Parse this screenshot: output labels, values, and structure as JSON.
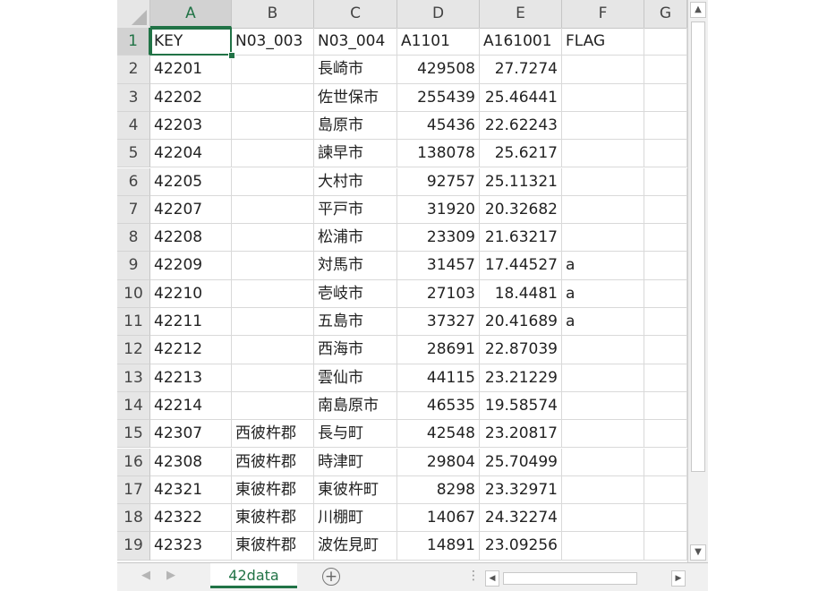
{
  "sheet": {
    "columns": [
      "A",
      "B",
      "C",
      "D",
      "E",
      "F",
      "G"
    ],
    "selected_column": "A",
    "selected_row": "1",
    "rows": [
      {
        "num": "1",
        "cells": [
          "KEY",
          "N03_003",
          "N03_004",
          "A1101",
          "A161001",
          "FLAG"
        ]
      },
      {
        "num": "2",
        "cells": [
          "42201",
          "",
          "長崎市",
          "429508",
          "27.7274",
          ""
        ]
      },
      {
        "num": "3",
        "cells": [
          "42202",
          "",
          "佐世保市",
          "255439",
          "25.46441",
          ""
        ]
      },
      {
        "num": "4",
        "cells": [
          "42203",
          "",
          "島原市",
          "45436",
          "22.62243",
          ""
        ]
      },
      {
        "num": "5",
        "cells": [
          "42204",
          "",
          "諫早市",
          "138078",
          "25.6217",
          ""
        ]
      },
      {
        "num": "6",
        "cells": [
          "42205",
          "",
          "大村市",
          "92757",
          "25.11321",
          ""
        ]
      },
      {
        "num": "7",
        "cells": [
          "42207",
          "",
          "平戸市",
          "31920",
          "20.32682",
          ""
        ]
      },
      {
        "num": "8",
        "cells": [
          "42208",
          "",
          "松浦市",
          "23309",
          "21.63217",
          ""
        ]
      },
      {
        "num": "9",
        "cells": [
          "42209",
          "",
          "対馬市",
          "31457",
          "17.44527",
          "a"
        ]
      },
      {
        "num": "10",
        "cells": [
          "42210",
          "",
          "壱岐市",
          "27103",
          "18.4481",
          "a"
        ]
      },
      {
        "num": "11",
        "cells": [
          "42211",
          "",
          "五島市",
          "37327",
          "20.41689",
          "a"
        ]
      },
      {
        "num": "12",
        "cells": [
          "42212",
          "",
          "西海市",
          "28691",
          "22.87039",
          ""
        ]
      },
      {
        "num": "13",
        "cells": [
          "42213",
          "",
          "雲仙市",
          "44115",
          "23.21229",
          ""
        ]
      },
      {
        "num": "14",
        "cells": [
          "42214",
          "",
          "南島原市",
          "46535",
          "19.58574",
          ""
        ]
      },
      {
        "num": "15",
        "cells": [
          "42307",
          "西彼杵郡",
          "長与町",
          "42548",
          "23.20817",
          ""
        ]
      },
      {
        "num": "16",
        "cells": [
          "42308",
          "西彼杵郡",
          "時津町",
          "29804",
          "25.70499",
          ""
        ]
      },
      {
        "num": "17",
        "cells": [
          "42321",
          "東彼杵郡",
          "東彼杵町",
          "8298",
          "23.32971",
          ""
        ]
      },
      {
        "num": "18",
        "cells": [
          "42322",
          "東彼杵郡",
          "川棚町",
          "14067",
          "24.32274",
          ""
        ]
      },
      {
        "num": "19",
        "cells": [
          "42323",
          "東彼杵郡",
          "波佐見町",
          "14891",
          "23.09256",
          ""
        ]
      }
    ]
  },
  "tabs": {
    "active_sheet": "42data",
    "add_sheet_icon": "plus-circle-icon"
  },
  "colors": {
    "accent": "#217346",
    "header_bg": "#e6e6e6",
    "gridline": "#d9d9d9"
  }
}
